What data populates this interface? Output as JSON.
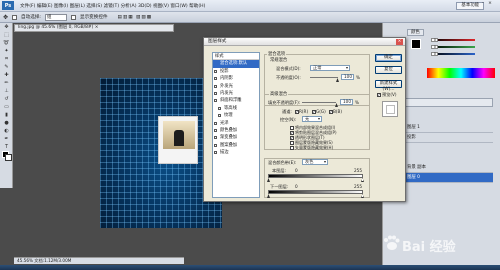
{
  "menubar": {
    "logo": "Ps",
    "menu_text": "文件(F)  编辑(E)  图像(I)  图层(L)  选择(S)  滤镜(T)  分析(A)  3D(D)  视图(V)  窗口(W)  帮助(H)",
    "workspace": "基本功能",
    "min": "–",
    "max": "□",
    "close": "×"
  },
  "optbar": {
    "auto_select": "自动选择:",
    "auto_select_value": "组",
    "show_transform": "显示变换控件"
  },
  "doc": {
    "tab": "ling.jpg @ 45.6% (图层 0, RGB/8#) ×",
    "status": "45.56%    文档:1.12M/3.00M"
  },
  "dialog": {
    "title": "图层样式",
    "close": "×",
    "styles_list": [
      {
        "label": "样式",
        "checkbox": false,
        "head": true
      },
      {
        "label": "混合选项:默认",
        "checkbox": false,
        "selected": true
      },
      {
        "label": "投影",
        "checkbox": true
      },
      {
        "label": "内阴影",
        "checkbox": true
      },
      {
        "label": "外发光",
        "checkbox": true
      },
      {
        "label": "内发光",
        "checkbox": true
      },
      {
        "label": "斜面和浮雕",
        "checkbox": true
      },
      {
        "label": "等高线",
        "checkbox": true,
        "indent": true
      },
      {
        "label": "纹理",
        "checkbox": true,
        "indent": true
      },
      {
        "label": "光泽",
        "checkbox": true
      },
      {
        "label": "颜色叠加",
        "checkbox": true
      },
      {
        "label": "渐变叠加",
        "checkbox": true
      },
      {
        "label": "图案叠加",
        "checkbox": true
      },
      {
        "label": "描边",
        "checkbox": true
      }
    ],
    "blend_group": "混合选项",
    "general_group": "常规混合",
    "blend_mode_label": "混合模式(D):",
    "blend_mode_value": "正常",
    "opacity_label": "不透明度(O):",
    "opacity_value": "100",
    "opacity_unit": "%",
    "advanced_group": "高级混合",
    "fill_opacity_label": "填充不透明度(F):",
    "fill_opacity_value": "100",
    "fill_unit": "%",
    "channels_label": "通道:",
    "channel_r": "R(R)",
    "channel_g": "G(G)",
    "channel_b": "B(B)",
    "knockout_label": "挖空(N):",
    "knockout_value": "无",
    "options": [
      {
        "label": "将内部效果混合成组(I)",
        "checked": false
      },
      {
        "label": "将剪贴图层混合成组(P)",
        "checked": true
      },
      {
        "label": "透明形状图层(T)",
        "checked": true
      },
      {
        "label": "图层蒙版隐藏效果(S)",
        "checked": false
      },
      {
        "label": "矢量蒙版隐藏效果(H)",
        "checked": false
      }
    ],
    "blend_if_label": "混合颜色带(E):",
    "blend_if_value": "灰色",
    "this_layer_label": "本图层:",
    "this_layer_min": "0",
    "this_layer_max": "255",
    "under_layer_label": "下一图层:",
    "under_layer_min": "0",
    "under_layer_max": "255",
    "buttons": {
      "ok": "确定",
      "cancel": "复位",
      "new_style": "新建样式(W)...",
      "preview": "预览(V)"
    }
  },
  "rpanel": {
    "tab_color": "颜色",
    "layers": [
      {
        "name": "图层 1"
      },
      {
        "name": "投影"
      },
      {
        "name": "背景 副本"
      },
      {
        "name": "图层 0"
      }
    ],
    "layer_mode": "正常",
    "channels": [
      {
        "name": "R",
        "value": "0",
        "color": "#e0262b"
      },
      {
        "name": "G",
        "value": "0",
        "color": "#3aa64c"
      },
      {
        "name": "B",
        "value": "0",
        "color": "#2c64c9"
      }
    ]
  },
  "watermark": {
    "text": "Bai 经验"
  },
  "colors": {
    "dialog_bg": "#ece9d8",
    "selection": "#316ac5",
    "canvas_blue": "#063561"
  }
}
